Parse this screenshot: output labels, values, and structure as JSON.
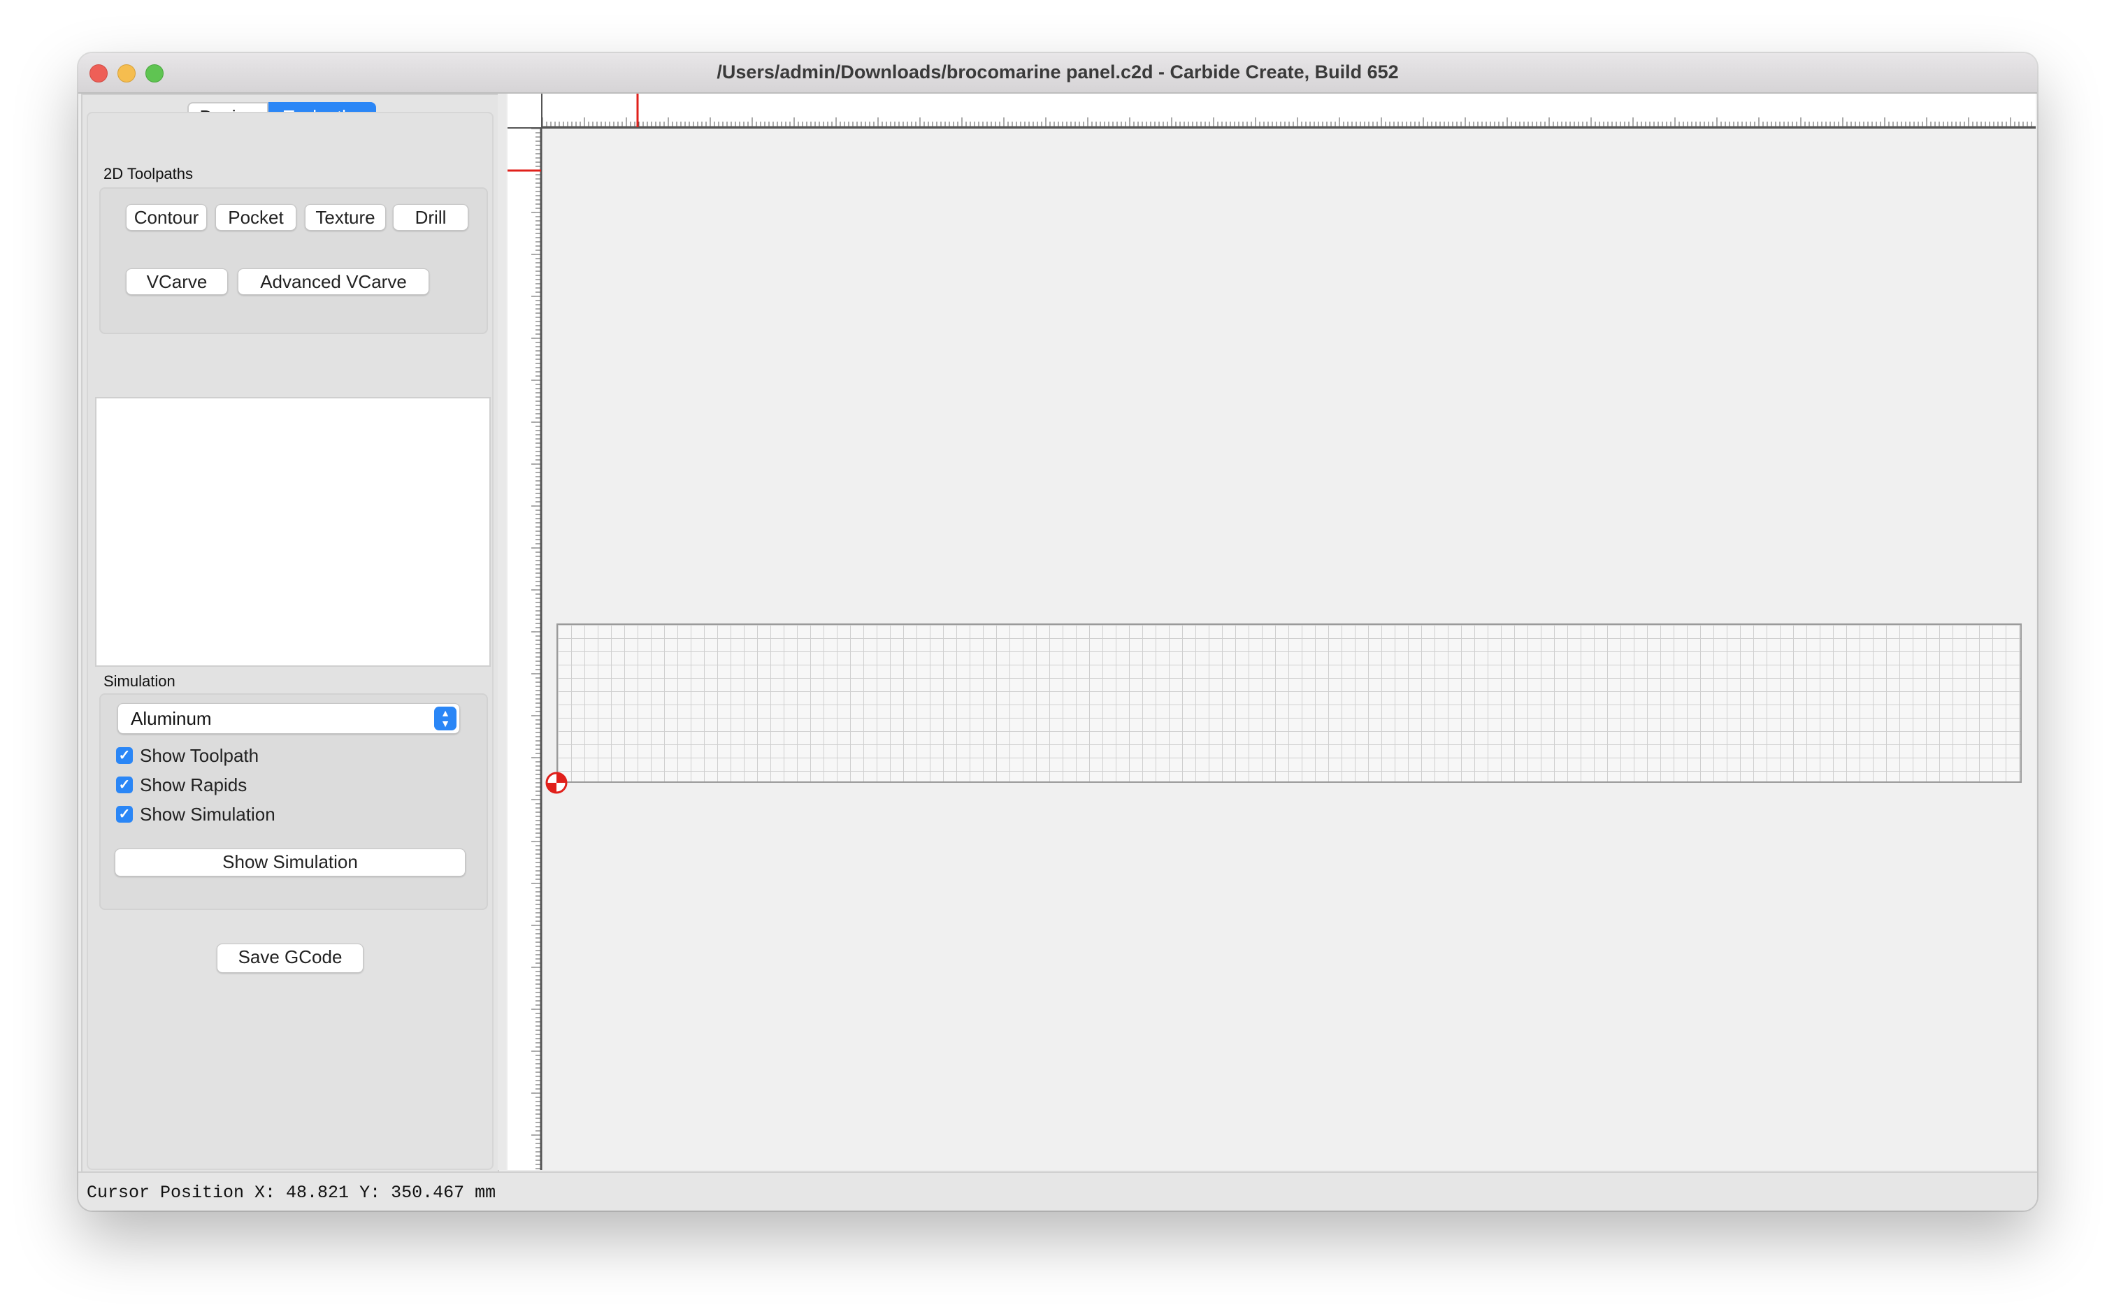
{
  "window": {
    "title": "/Users/admin/Downloads/brocomarine panel.c2d - Carbide Create, Build 652"
  },
  "tabs": [
    {
      "label": "Design",
      "active": false
    },
    {
      "label": "Toolpaths",
      "active": true
    }
  ],
  "toolpaths_2d": {
    "label": "2D Toolpaths",
    "buttons": [
      "Contour",
      "Pocket",
      "Texture",
      "Drill",
      "VCarve",
      "Advanced VCarve"
    ]
  },
  "simulation": {
    "label": "Simulation",
    "material": "Aluminum",
    "checkboxes": [
      {
        "label": "Show Toolpath",
        "checked": true
      },
      {
        "label": "Show Rapids",
        "checked": true
      },
      {
        "label": "Show Simulation",
        "checked": true
      }
    ],
    "show_button": "Show Simulation"
  },
  "save_gcode": "Save GCode",
  "status": {
    "cursor_position": "Cursor Position X: 48.821 Y: 350.467 mm"
  },
  "colors": {
    "accent": "#2a86f6",
    "marker": "#e0201b"
  }
}
